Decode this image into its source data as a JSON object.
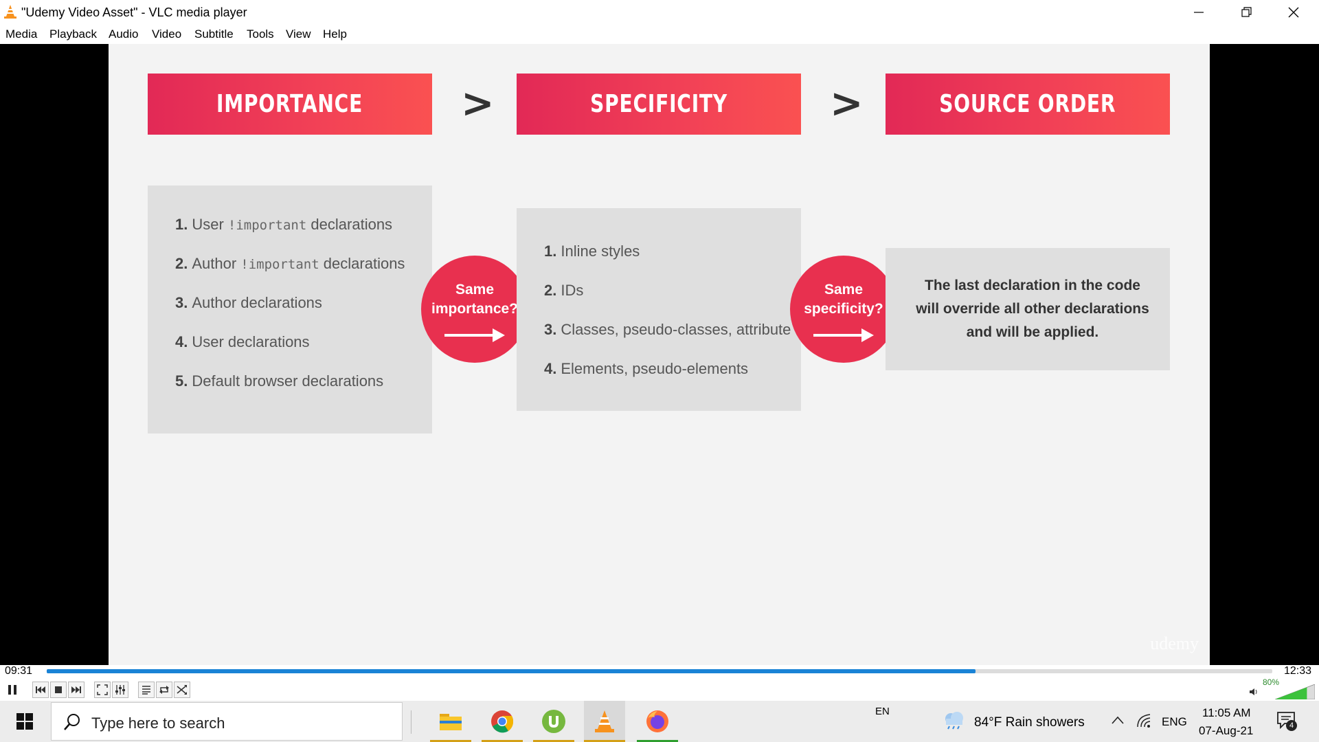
{
  "window": {
    "title": "\"Udemy Video Asset\" - VLC media player"
  },
  "menu": [
    "Media",
    "Playback",
    "Audio",
    "Video",
    "Subtitle",
    "Tools",
    "View",
    "Help"
  ],
  "slide": {
    "banners": [
      "IMPORTANCE",
      "SPECIFICITY",
      "SOURCE ORDER"
    ],
    "separator": ">",
    "importance_list": [
      {
        "num": "1.",
        "pre": "User ",
        "code": "!important",
        "post": " declarations"
      },
      {
        "num": "2.",
        "pre": "Author ",
        "code": "!important",
        "post": " declarations"
      },
      {
        "num": "3.",
        "pre": "Author declarations",
        "code": "",
        "post": ""
      },
      {
        "num": "4.",
        "pre": "User declarations",
        "code": "",
        "post": ""
      },
      {
        "num": "5.",
        "pre": "Default browser declarations",
        "code": "",
        "post": ""
      }
    ],
    "specificity_list": [
      {
        "num": "1.",
        "text": "Inline styles"
      },
      {
        "num": "2.",
        "text": "IDs"
      },
      {
        "num": "3.",
        "text": "Classes, pseudo-classes, attribute"
      },
      {
        "num": "4.",
        "text": "Elements, pseudo-elements"
      }
    ],
    "circle1": {
      "line1": "Same",
      "line2": "importance?"
    },
    "circle2": {
      "line1": "Same",
      "line2": "specificity?"
    },
    "final_text": "The last declaration in the code will override all other declarations and will be applied.",
    "watermark": "udemy"
  },
  "player": {
    "elapsed": "09:31",
    "total": "12:33",
    "progress": 0.758,
    "volume_label": "80%",
    "volume": 0.8
  },
  "taskbar": {
    "search_placeholder": "Type here to search",
    "lang_short": "EN",
    "weather": "84°F  Rain showers",
    "lang": "ENG",
    "time": "11:05 AM",
    "date": "07-Aug-21",
    "notifications": "4"
  },
  "colors": {
    "accent_red": "#e8304f",
    "progress_blue": "#1a83d6"
  }
}
